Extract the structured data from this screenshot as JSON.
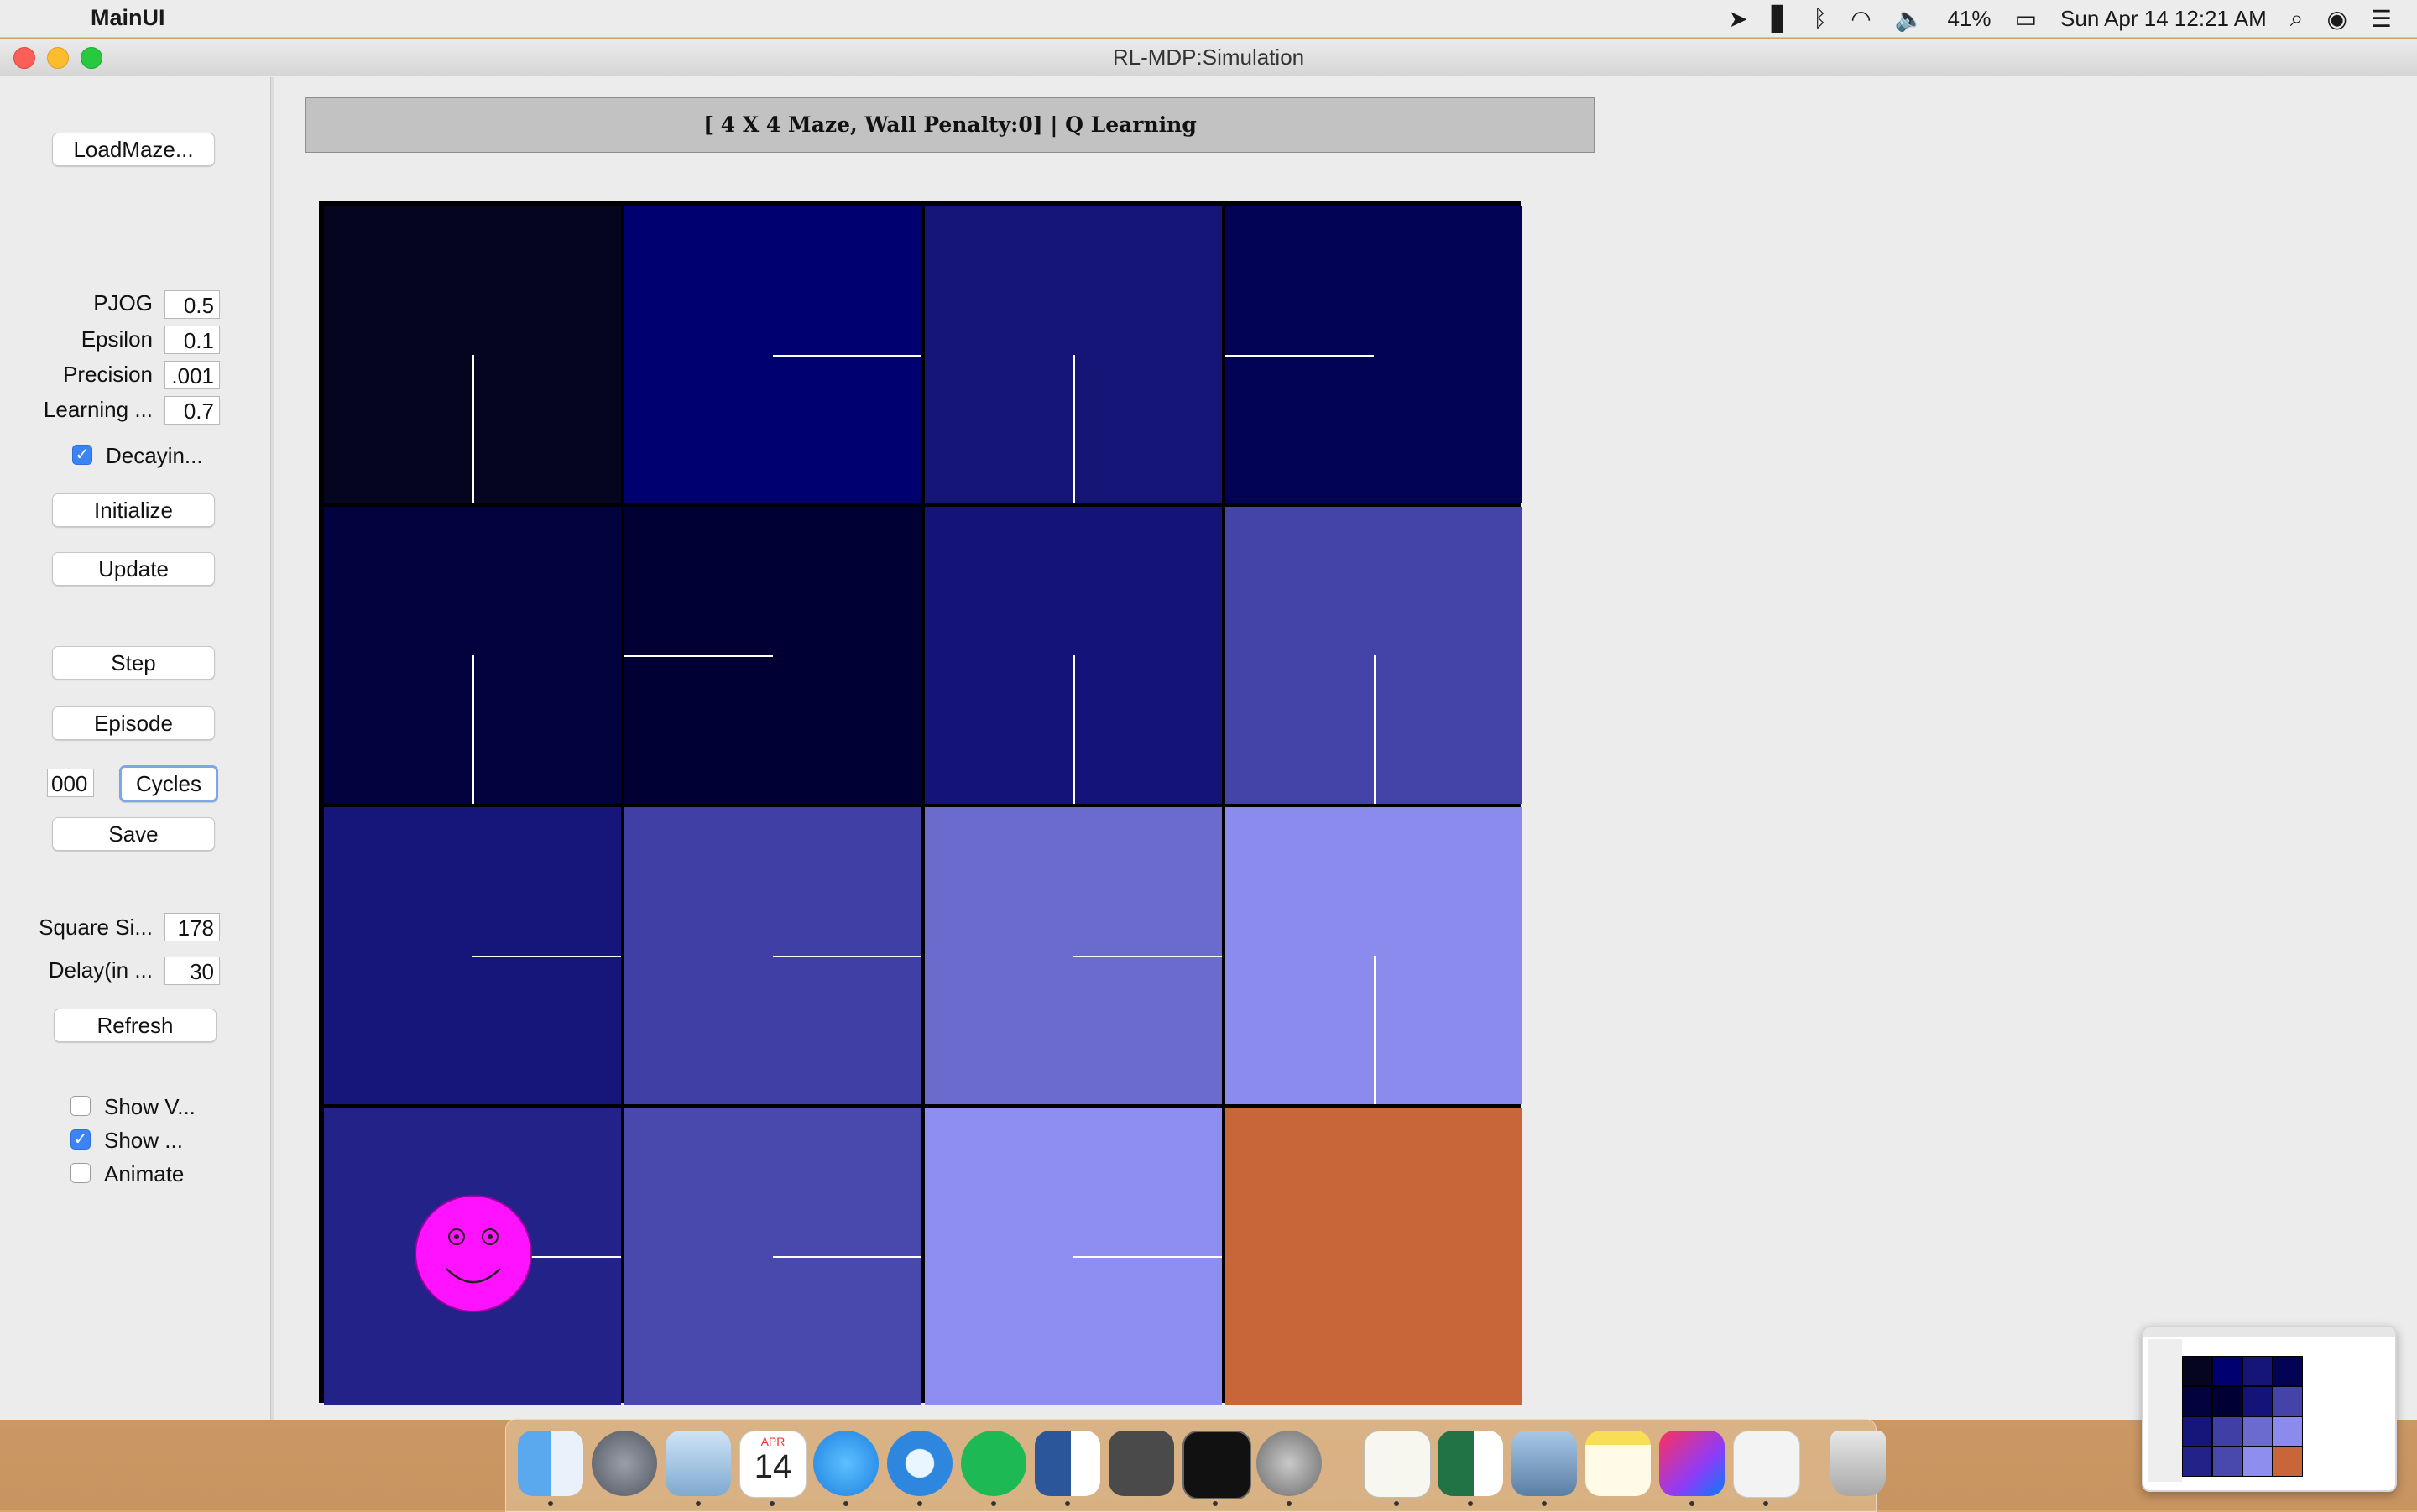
{
  "menubar": {
    "app_name": "MainUI",
    "battery": "41%",
    "clock": "Sun Apr 14  12:21 AM"
  },
  "window": {
    "title": "RL-MDP:Simulation"
  },
  "panel": {
    "load_maze_label": "LoadMaze...",
    "params": [
      {
        "label": "PJOG",
        "value": "0.5"
      },
      {
        "label": "Epsilon",
        "value": "0.1"
      },
      {
        "label": "Precision",
        "value": ".001"
      },
      {
        "label": "Learning ...",
        "value": "0.7"
      }
    ],
    "decaying_label": "Decayin...",
    "decaying_checked": true,
    "initialize_label": "Initialize",
    "update_label": "Update",
    "step_label": "Step",
    "episode_label": "Episode",
    "cycles_value": "000",
    "cycles_label": "Cycles",
    "save_label": "Save",
    "square_size_label": "Square Si...",
    "square_size_value": "178",
    "delay_label": "Delay(in ...",
    "delay_value": "30",
    "refresh_label": "Refresh",
    "show_v_label": "Show V...",
    "show_v_checked": false,
    "show_label": "Show ...",
    "show_checked": true,
    "animate_label": "Animate",
    "animate_checked": false
  },
  "header": {
    "text": "[ 4 X 4 Maze, Wall Penalty:0] |  Q Learning"
  },
  "maze": {
    "rows": 4,
    "cols": 4,
    "cell_colors": [
      [
        "#05051f",
        "#000070",
        "#151578",
        "#030356"
      ],
      [
        "#02023f",
        "#000034",
        "#13137a",
        "#4444a8"
      ],
      [
        "#15157a",
        "#3f3fa6",
        "#6b6bcd",
        "#8b8bee"
      ],
      [
        "#222288",
        "#4848ad",
        "#8d8ef0",
        "#c8663a"
      ]
    ],
    "arrows": [
      [
        "down",
        "right",
        "down",
        "left"
      ],
      [
        "down",
        "left",
        "down",
        "down"
      ],
      [
        "right",
        "right",
        "right",
        "down"
      ],
      [
        "right",
        "right",
        "right",
        "none"
      ]
    ],
    "agent_position": [
      3,
      0
    ],
    "agent_color": "#ff12ff",
    "goal_color": "#c8663a"
  },
  "dock": {
    "apps": [
      "finder-icon",
      "launchpad-icon",
      "mail-icon",
      "calendar-icon",
      "messages-icon",
      "safari-icon",
      "spotify-icon",
      "word-icon",
      "sublime-icon",
      "terminal-icon",
      "preferences-icon",
      "textedit-icon",
      "excel-icon",
      "preview-icon",
      "notes-icon",
      "intellij-icon",
      "java-icon",
      "trash-icon"
    ],
    "calendar_month": "APR",
    "calendar_day": "14"
  }
}
